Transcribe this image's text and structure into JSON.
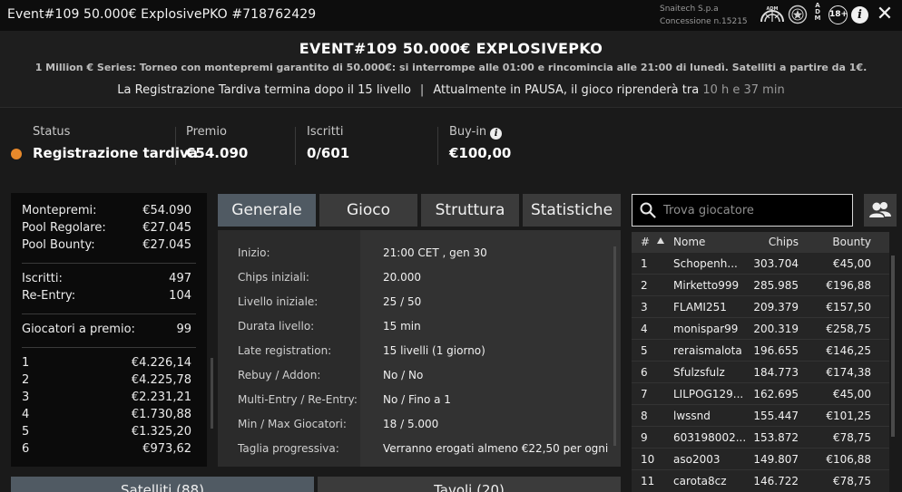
{
  "window": {
    "title": "Event#109 50.000€ ExplosivePKO #718762429",
    "company": "Snaitech S.p.a",
    "concession": "Concessione n.15215",
    "adm_text": "ADM",
    "adm_vertical": [
      "A",
      "D",
      "M"
    ],
    "age_label": "18+",
    "info_glyph": "i",
    "close_glyph": "✕"
  },
  "header": {
    "title": "EVENT#109 50.000€ EXPLOSIVEPKO",
    "subtitle": "1 Million € Series: Torneo con montepremi garantito di 50.000€: si interrompe alle 01:00 e rincomincia alle 21:00 di lunedì. Satelliti a partire da 1€.",
    "notice_left": "La Registrazione Tardiva termina dopo il 15 livello",
    "notice_sep": "|",
    "notice_right": "Attualmente in PAUSA, il gioco riprenderà tra",
    "notice_time": "10 h e 37 min"
  },
  "stats": {
    "status_label": "Status",
    "status_value": "Registrazione tardiva",
    "status_color": "#e8892b",
    "premio_label": "Premio",
    "premio_value": "€54.090",
    "iscritti_label": "Iscritti",
    "iscritti_value": "0/601",
    "buyin_label": "Buy-in",
    "buyin_value": "€100,00"
  },
  "prize_panel": {
    "montepremi_label": "Montepremi:",
    "montepremi_value": "€54.090",
    "pool_regolare_label": "Pool Regolare:",
    "pool_regolare_value": "€27.045",
    "pool_bounty_label": "Pool Bounty:",
    "pool_bounty_value": "€27.045",
    "iscritti_label": "Iscritti:",
    "iscritti_value": "497",
    "reentry_label": "Re-Entry:",
    "reentry_value": "104",
    "giocatori_label": "Giocatori a premio:",
    "giocatori_value": "99",
    "payouts": [
      {
        "pos": "1",
        "amount": "€4.226,14"
      },
      {
        "pos": "2",
        "amount": "€4.225,78"
      },
      {
        "pos": "3",
        "amount": "€2.231,21"
      },
      {
        "pos": "4",
        "amount": "€1.730,88"
      },
      {
        "pos": "5",
        "amount": "€1.325,20"
      },
      {
        "pos": "6",
        "amount": "€973,62"
      }
    ]
  },
  "tabs": {
    "generale": "Generale",
    "gioco": "Gioco",
    "struttura": "Struttura",
    "statistiche": "Statistiche"
  },
  "details": [
    {
      "label": "Inizio:",
      "value": "21:00 CET , gen 30"
    },
    {
      "label": "Chips iniziali:",
      "value": "20.000"
    },
    {
      "label": "Livello iniziale:",
      "value": "25 / 50"
    },
    {
      "label": "Durata livello:",
      "value": "15 min"
    },
    {
      "label": "Late registration:",
      "value": "15 livelli (1 giorno)"
    },
    {
      "label": "Rebuy / Addon:",
      "value": "No / No"
    },
    {
      "label": "Multi-Entry / Re-Entry:",
      "value": "No / Fino a 1"
    },
    {
      "label": "Min / Max Giocatori:",
      "value": "18 / 5.000"
    },
    {
      "label": "Taglia progressiva:",
      "value": "Verranno erogati almeno €22,50 per ogni"
    }
  ],
  "search": {
    "placeholder": "Trova giocatore"
  },
  "players_table": {
    "headers": {
      "rank": "#",
      "name": "Nome",
      "chips": "Chips",
      "bounty": "Bounty"
    },
    "rows": [
      {
        "rank": "1",
        "name": "Schopenh...",
        "chips": "303.704",
        "bounty": "€45,00"
      },
      {
        "rank": "2",
        "name": "Mirketto999",
        "chips": "285.985",
        "bounty": "€196,88"
      },
      {
        "rank": "3",
        "name": "FLAMI251",
        "chips": "209.379",
        "bounty": "€157,50"
      },
      {
        "rank": "4",
        "name": "monispar99",
        "chips": "200.319",
        "bounty": "€258,75"
      },
      {
        "rank": "5",
        "name": "reraismalota",
        "chips": "196.655",
        "bounty": "€146,25"
      },
      {
        "rank": "6",
        "name": "Sfulzsfulz",
        "chips": "184.773",
        "bounty": "€174,38"
      },
      {
        "rank": "7",
        "name": "LILPOG129...",
        "chips": "162.695",
        "bounty": "€45,00"
      },
      {
        "rank": "8",
        "name": "lwssnd",
        "chips": "155.447",
        "bounty": "€101,25"
      },
      {
        "rank": "9",
        "name": "603198002...",
        "chips": "153.872",
        "bounty": "€78,75"
      },
      {
        "rank": "10",
        "name": "aso2003",
        "chips": "149.807",
        "bounty": "€106,88"
      },
      {
        "rank": "11",
        "name": "carota8cz",
        "chips": "146.722",
        "bounty": "€78,75"
      }
    ]
  },
  "bottom": {
    "satelliti": "Satelliti (88)",
    "tavoli": "Tavoli (20)"
  }
}
